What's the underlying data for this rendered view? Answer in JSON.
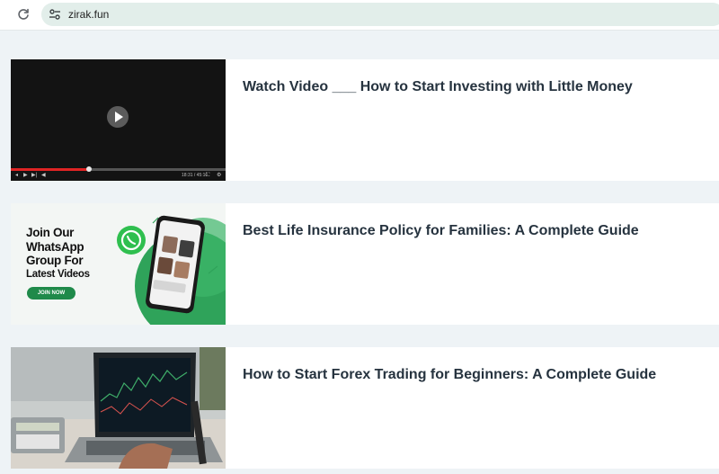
{
  "browser": {
    "url": "zirak.fun",
    "icons": {
      "reload": "reload-icon",
      "site_info": "tune-icon",
      "forward": "arrow-right-icon"
    }
  },
  "posts": [
    {
      "title": "Watch Video ___ How to Start Investing with Little Money",
      "thumbnail": "video-player"
    },
    {
      "title": "Best Life Insurance Policy for Families: A Complete Guide",
      "thumbnail": "whatsapp-banner"
    },
    {
      "title": "How to Start Forex Trading for Beginners: A Complete Guide",
      "thumbnail": "laptop-trading-chart"
    }
  ],
  "video": {
    "time": "18:31 / 45:16",
    "progress_fraction": 0.36
  },
  "wa_banner": {
    "line1": "Join Our",
    "line2": "WhatsApp",
    "line3": "Group For",
    "line4": "Latest Videos",
    "button": "JOIN NOW"
  },
  "colors": {
    "accent_green": "#1f8a4a",
    "title": "#26333f",
    "background": "#eef3f6",
    "progress_red": "#e02424"
  }
}
